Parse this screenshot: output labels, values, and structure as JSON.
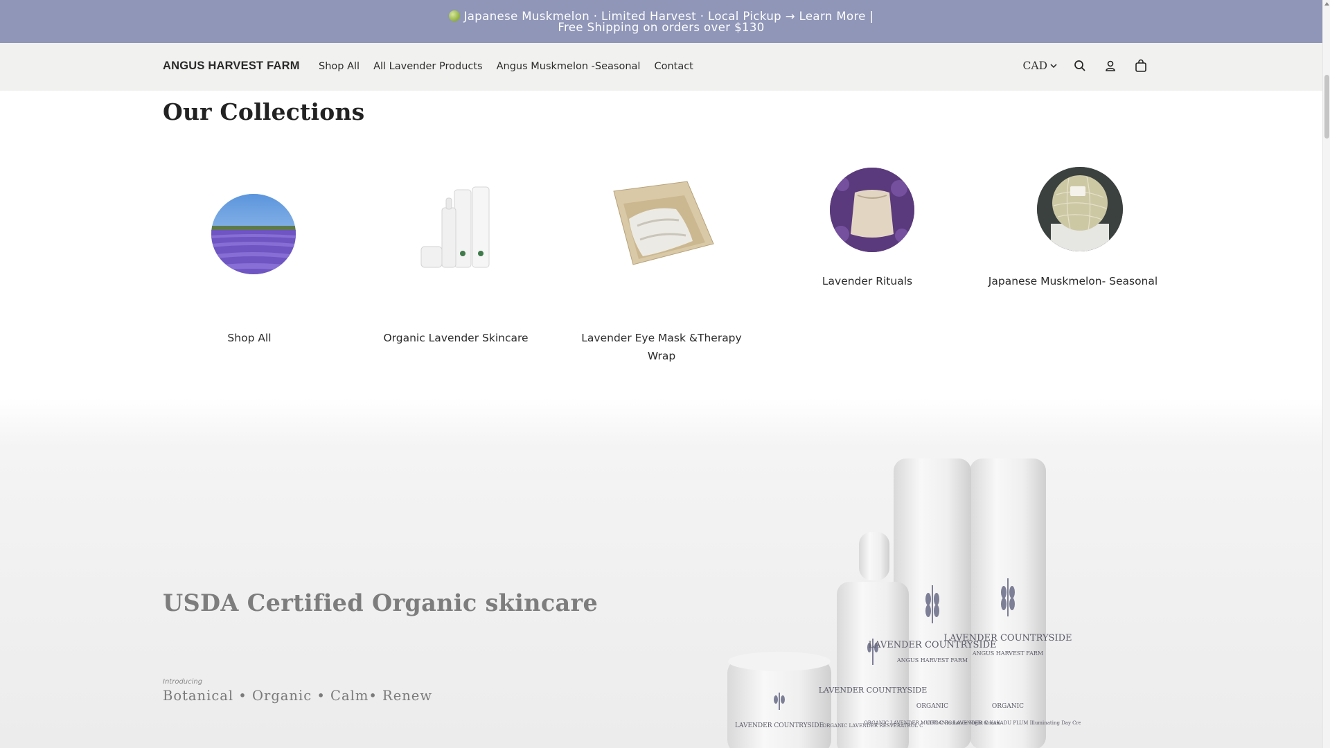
{
  "announcement": {
    "text": "Japanese Muskmelon · Limited Harvest · Local Pickup → Learn More | Free Shipping on orders over $130"
  },
  "header": {
    "brand": "ANGUS HARVEST FARM",
    "nav": [
      "Shop All",
      "All Lavender Products",
      "Angus Muskmelon -Seasonal",
      "Contact"
    ],
    "currency": "CAD",
    "icons": [
      "search-icon",
      "account-icon",
      "cart-icon",
      "chevron-down-icon"
    ]
  },
  "collections": {
    "title": "Our Collections",
    "items": [
      {
        "label": "Shop All",
        "image": "lavender-field-image"
      },
      {
        "label": "Organic Lavender Skincare",
        "image": "skincare-bottles-image"
      },
      {
        "label": "Lavender Eye Mask &Therapy Wrap",
        "image": "eye-mask-box-image"
      },
      {
        "label": "Lavender Rituals",
        "image": "lavender-sachet-image"
      },
      {
        "label": "Japanese Muskmelon- Seasonal",
        "image": "muskmelon-image"
      }
    ]
  },
  "hero": {
    "title": "USDA Certified Organic skincare",
    "intro": "Introducing",
    "subtitle": "Botanical • Organic • Calm• Renew",
    "product_brand": "LAVENDER COUNTRYSIDE",
    "product_farm": "ANGUS HARVEST FARM",
    "product_organic": "ORGANIC",
    "products": [
      "ORGANIC LAVENDER RESVERATROL C",
      "ORGANIC LAVENDER MULTI-C Radiance Night Cream",
      "ORGANIC LAVENDER & KAKADU PLUM Illuminating Day Cream"
    ]
  }
}
